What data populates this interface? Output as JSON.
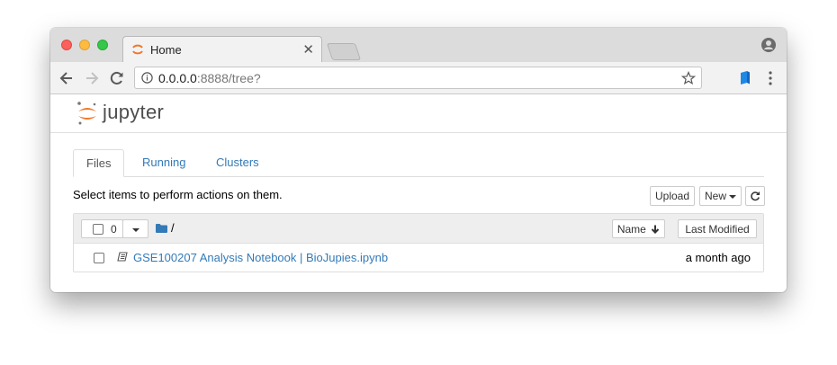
{
  "browser": {
    "tab": {
      "title": "Home"
    },
    "address": {
      "host": "0.0.0.0",
      "rest": ":8888/tree?"
    }
  },
  "app": {
    "logo_text": "jupyter"
  },
  "tabs": [
    {
      "label": "Files",
      "active": true
    },
    {
      "label": "Running",
      "active": false
    },
    {
      "label": "Clusters",
      "active": false
    }
  ],
  "toolbar": {
    "hint": "Select items to perform actions on them.",
    "upload_label": "Upload",
    "new_label": "New",
    "refresh_icon": "refresh-icon"
  },
  "listing": {
    "selected_count": "0",
    "breadcrumb_path": "/",
    "sort_name_label": "Name",
    "sort_modified_label": "Last Modified",
    "items": [
      {
        "name": "GSE100207 Analysis Notebook | BioJupies.ipynb",
        "modified": "a month ago",
        "icon": "notebook-icon"
      }
    ]
  },
  "colors": {
    "link": "#337ab7",
    "jupyter_orange": "#f37726"
  }
}
